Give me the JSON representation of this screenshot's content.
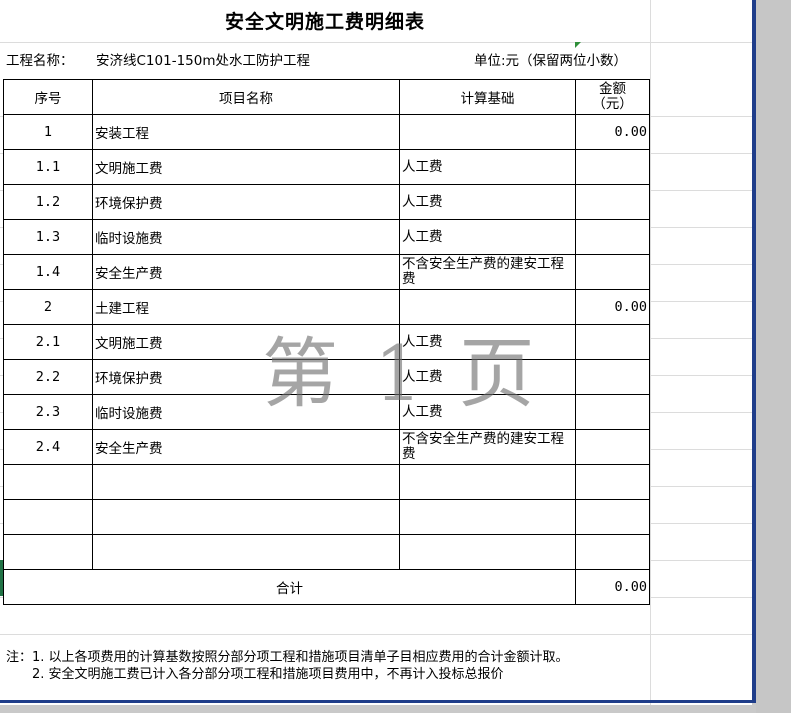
{
  "sheet": {
    "title": "安全文明施工费明细表",
    "project_label": "工程名称：",
    "project_name": "安济线C101-150m处水工防护工程",
    "unit_text": "单位:元（保留两位小数）",
    "watermark": "第 1 页"
  },
  "table": {
    "headers": {
      "seq": "序号",
      "name": "项目名称",
      "basis": "计算基础",
      "amount_line1": "金额",
      "amount_line2": "（元）"
    },
    "rows": [
      {
        "seq": "1",
        "name": "安装工程",
        "basis": "",
        "amount": "0.00"
      },
      {
        "seq": "1.1",
        "name": "文明施工费",
        "basis": "人工费",
        "amount": ""
      },
      {
        "seq": "1.2",
        "name": "环境保护费",
        "basis": "人工费",
        "amount": ""
      },
      {
        "seq": "1.3",
        "name": "临时设施费",
        "basis": "人工费",
        "amount": ""
      },
      {
        "seq": "1.4",
        "name": "安全生产费",
        "basis": "不含安全生产费的建安工程费",
        "amount": ""
      },
      {
        "seq": "2",
        "name": "土建工程",
        "basis": "",
        "amount": "0.00"
      },
      {
        "seq": "2.1",
        "name": "文明施工费",
        "basis": "人工费",
        "amount": ""
      },
      {
        "seq": "2.2",
        "name": "环境保护费",
        "basis": "人工费",
        "amount": ""
      },
      {
        "seq": "2.3",
        "name": "临时设施费",
        "basis": "人工费",
        "amount": ""
      },
      {
        "seq": "2.4",
        "name": "安全生产费",
        "basis": "不含安全生产费的建安工程费",
        "amount": ""
      },
      {
        "seq": "",
        "name": "",
        "basis": "",
        "amount": ""
      },
      {
        "seq": "",
        "name": "",
        "basis": "",
        "amount": ""
      },
      {
        "seq": "",
        "name": "",
        "basis": "",
        "amount": ""
      }
    ],
    "total_label": "合计",
    "total_amount": "0.00"
  },
  "notes": {
    "line1": "注：1. 以上各项费用的计算基数按照分部分项工程和措施项目清单子目相应费用的合计金额计取。",
    "line2": "2. 安全文明施工费已计入各分部分项工程和措施项目费用中，不再计入投标总报价"
  },
  "colors": {
    "page_border": "#1f3d8a",
    "background": "#c6c6c6",
    "cell_marker": "#217346"
  }
}
